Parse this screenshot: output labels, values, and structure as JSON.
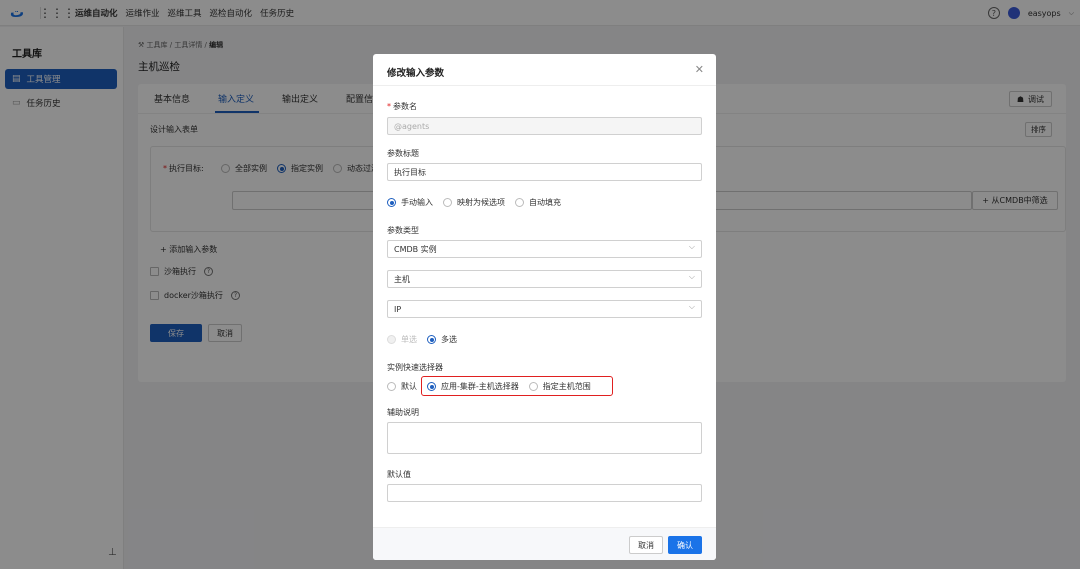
{
  "topbar": {
    "logo": "ت",
    "nav": [
      "运维自动化",
      "运维作业",
      "巡维工具",
      "巡检自动化",
      "任务历史"
    ],
    "help": "?",
    "user": "easyops"
  },
  "sidebar": {
    "title": "工具库",
    "items": [
      {
        "label": "工具管理",
        "active": true
      },
      {
        "label": "任务历史",
        "active": false
      }
    ]
  },
  "page": {
    "breadcrumb": [
      "工具库",
      "工具详情",
      "编辑"
    ],
    "title": "主机巡检",
    "tabs": [
      "基本信息",
      "输入定义",
      "输出定义",
      "配置信"
    ],
    "debug_label": "调试",
    "form_title": "设计输入表单",
    "sort_label": "排序",
    "target_label": "执行目标:",
    "target_options": [
      "全部实例",
      "指定实例",
      "动态过滤"
    ],
    "cmdb_button": "+ 从CMDB中筛选",
    "add_param": "+ 添加输入参数",
    "sandbox": "沙箱执行",
    "docker_sandbox": "docker沙箱执行",
    "save": "保存",
    "cancel": "取消"
  },
  "modal": {
    "title": "修改输入参数",
    "param_name_label": "参数名",
    "param_name_placeholder": "@agents",
    "param_title_label": "参数标题",
    "param_title_value": "执行目标",
    "input_modes": [
      "手动输入",
      "映射为候选项",
      "自动填充"
    ],
    "param_type_label": "参数类型",
    "param_type_value": "CMDB 实例",
    "object_value": "主机",
    "attr_value": "IP",
    "select_modes": [
      "单选",
      "多选"
    ],
    "quick_selector_label": "实例快速选择器",
    "quick_selector_options": [
      "默认",
      "应用-集群-主机选择器",
      "指定主机范围"
    ],
    "help_label": "辅助说明",
    "default_label": "默认值",
    "cancel": "取消",
    "ok": "确认"
  }
}
